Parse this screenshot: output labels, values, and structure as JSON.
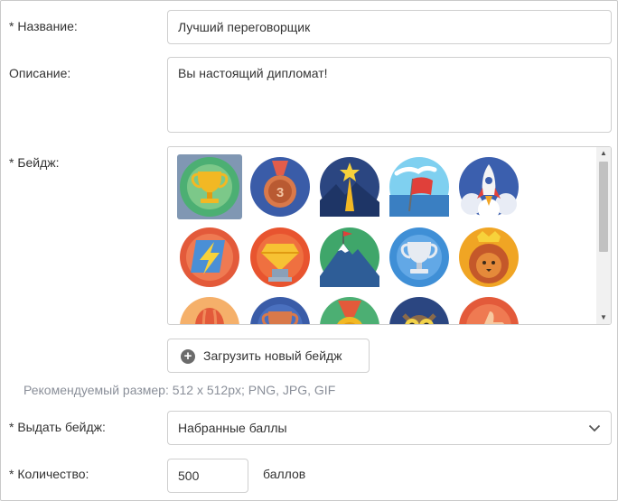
{
  "form": {
    "name_label": "* Название:",
    "name_value": "Лучший переговорщик",
    "description_label": "Описание:",
    "description_value": "Вы настоящий дипломат!",
    "badge_label": "* Бейдж:",
    "upload_button_label": "Загрузить новый бейдж",
    "recommended_hint": "Рекомендуемый размер: 512 x 512px; PNG, JPG, GIF",
    "award_label": "* Выдать бейдж:",
    "award_value": "Набранные баллы",
    "quantity_label": "* Количество:",
    "quantity_value": "500",
    "quantity_unit": "баллов"
  },
  "badges": [
    {
      "icon": "trophy-icon",
      "selected": true
    },
    {
      "icon": "medal-3-icon",
      "selected": false
    },
    {
      "icon": "star-peak-icon",
      "selected": false
    },
    {
      "icon": "flag-icon",
      "selected": false
    },
    {
      "icon": "rocket-icon",
      "selected": false
    },
    {
      "icon": "lightning-icon",
      "selected": false
    },
    {
      "icon": "diamond-icon",
      "selected": false
    },
    {
      "icon": "mountain-flag-icon",
      "selected": false
    },
    {
      "icon": "silver-cup-icon",
      "selected": false
    },
    {
      "icon": "lion-icon",
      "selected": false
    },
    {
      "icon": "balloon-icon",
      "selected": false
    },
    {
      "icon": "bronze-cup-icon",
      "selected": false
    },
    {
      "icon": "green-medal-icon",
      "selected": false
    },
    {
      "icon": "owl-icon",
      "selected": false
    },
    {
      "icon": "thumbs-up-icon",
      "selected": false
    }
  ],
  "colors": {
    "selected_badge_bg": "#8097b3",
    "border": "#cfcfcf",
    "hint_text": "#8a8f99"
  }
}
